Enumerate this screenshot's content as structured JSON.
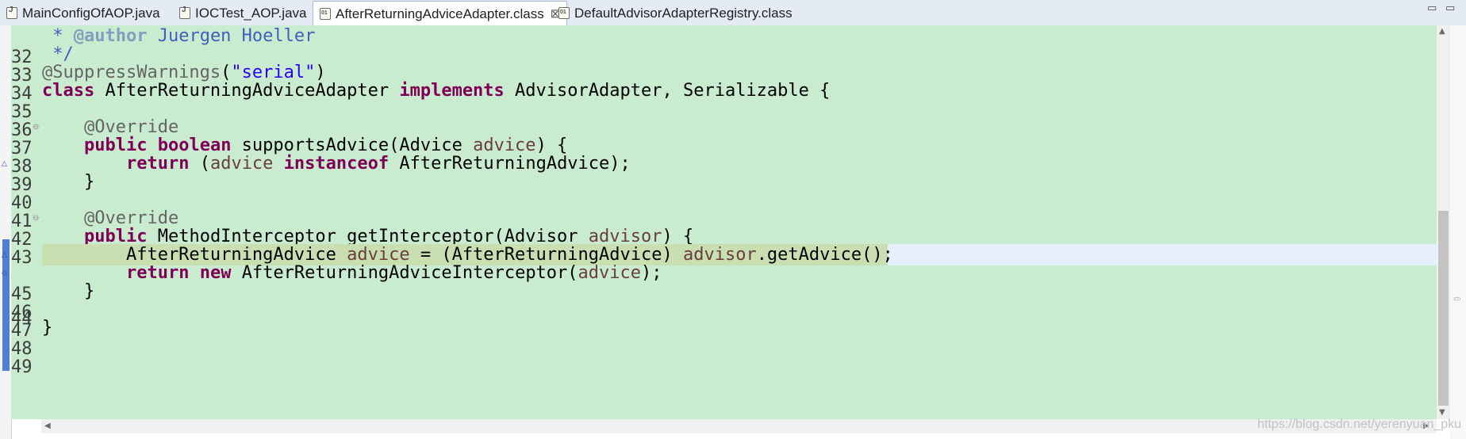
{
  "tabs": [
    {
      "label": "MainConfigOfAOP.java",
      "icon": "java-file-icon"
    },
    {
      "label": "IOCTest_AOP.java",
      "icon": "java-file-icon"
    },
    {
      "label": "AfterReturningAdviceAdapter.class",
      "icon": "class-file-icon",
      "active": true,
      "close": "⊠"
    },
    {
      "label": "DefaultAdvisorAdapterRegistry.class",
      "icon": "class-file-icon"
    }
  ],
  "window_controls": {
    "minimize": "▭",
    "maximize": "▭"
  },
  "editor": {
    "line_numbers": [
      "32",
      "33",
      "34",
      "35",
      "36",
      "37",
      "38",
      "39",
      "40",
      "41",
      "42",
      "43",
      "44",
      "45",
      "46",
      "47",
      "48",
      "49"
    ],
    "code_text": [
      " * @author Juergen Hoeller",
      " */",
      "@SuppressWarnings(\"serial\")",
      "class AfterReturningAdviceAdapter implements AdvisorAdapter, Serializable {",
      "",
      "    @Override",
      "    public boolean supportsAdvice(Advice advice) {",
      "        return (advice instanceof AfterReturningAdvice);",
      "    }",
      "",
      "    @Override",
      "    public MethodInterceptor getInterceptor(Advisor advisor) {",
      "        AfterReturningAdvice advice = (AfterReturningAdvice) advisor.getAdvice();",
      "        return new AfterReturningAdviceInterceptor(advice);",
      "    }",
      "",
      "}",
      ""
    ],
    "current_line": "44",
    "colors": {
      "background": "#c9ecd0",
      "keyword": "#7f0055",
      "annotation": "#646464",
      "javadoc": "#3f5fbf",
      "string": "#2a00ff",
      "variable": "#6a3e3e"
    }
  },
  "scroll": {
    "vertical_position": 0.47
  },
  "watermark": "https://blog.csdn.net/yerenyuan_pku"
}
